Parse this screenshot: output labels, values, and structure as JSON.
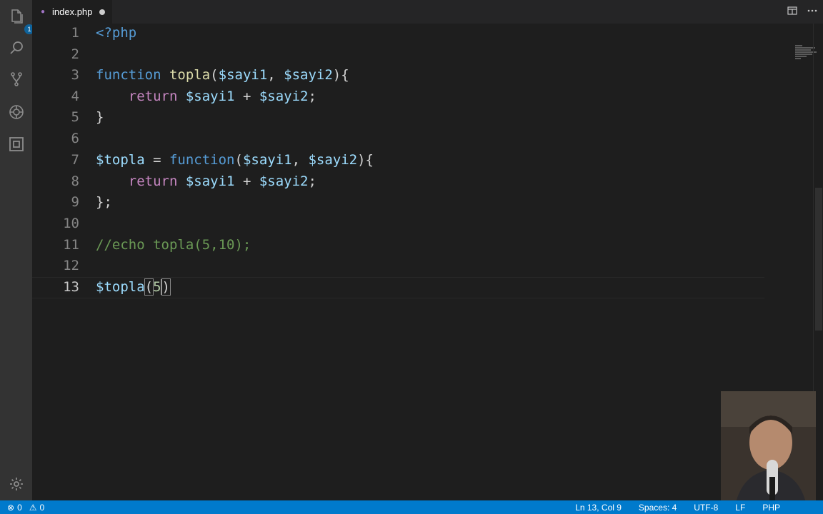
{
  "tab": {
    "filename": "index.php"
  },
  "activity": {
    "explorer_badge": "1"
  },
  "editor": {
    "line_numbers": [
      "1",
      "2",
      "3",
      "4",
      "5",
      "6",
      "7",
      "8",
      "9",
      "10",
      "11",
      "12",
      "13"
    ],
    "code": {
      "l1": "<?php",
      "l3_kw": "function",
      "l3_fn": "topla",
      "l3_p1": "(",
      "l3_v1": "$sayi1",
      "l3_c": ", ",
      "l3_v2": "$sayi2",
      "l3_p2": "){",
      "l4_ret": "return",
      "l4_v1": "$sayi1",
      "l4_op": " + ",
      "l4_v2": "$sayi2",
      "l4_end": ";",
      "l5": "}",
      "l7_var": "$topla",
      "l7_eq": " = ",
      "l7_kw": "function",
      "l7_p1": "(",
      "l7_v1": "$sayi1",
      "l7_c": ", ",
      "l7_v2": "$sayi2",
      "l7_p2": "){",
      "l8_ret": "return",
      "l8_v1": "$sayi1",
      "l8_op": " + ",
      "l8_v2": "$sayi2",
      "l8_end": ";",
      "l9": "};",
      "l11": "//echo topla(5,10);",
      "l13_var": "$topla",
      "l13_open": "(",
      "l13_arg": "5",
      "l13_close": ")"
    }
  },
  "status": {
    "errors": "0",
    "warnings": "0",
    "position": "Ln 13, Col 9",
    "spaces": "Spaces: 4",
    "encoding": "UTF-8",
    "eol": "LF",
    "language": "PHP"
  },
  "colors": {
    "status_bar": "#007acc",
    "editor_bg": "#1e1e1e",
    "keyword": "#569cd6",
    "function": "#dcdcaa",
    "variable": "#9cdcfe",
    "control": "#c586c0",
    "comment": "#6a9955"
  }
}
